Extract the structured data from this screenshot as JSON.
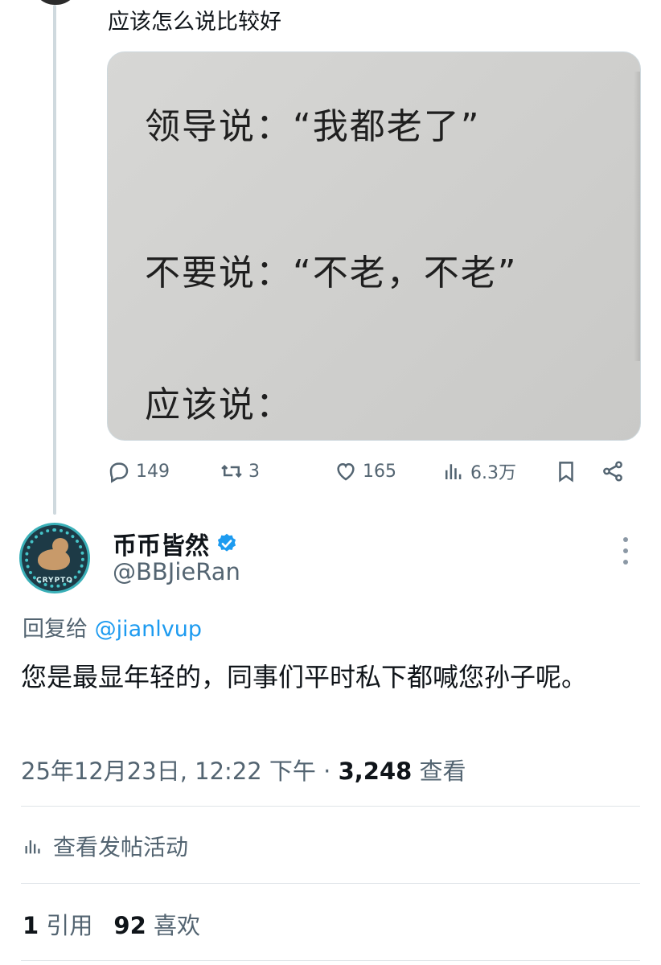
{
  "parent_tweet": {
    "text": "应该怎么说比较好",
    "media": {
      "line1": "领导说：“我都老了”",
      "line2": "不要说：“不老，不老”",
      "line3": "应该说："
    },
    "actions": {
      "replies": "149",
      "retweets": "3",
      "likes": "165",
      "views": "6.3万"
    },
    "icons": [
      "reply-icon",
      "retweet-icon",
      "like-icon",
      "views-icon",
      "bookmark-icon",
      "share-icon"
    ]
  },
  "reply_tweet": {
    "display_name": "币币皆然",
    "handle": "@BBJieRan",
    "reply_to_prefix": "回复给",
    "reply_to_mention": "@jianlvup",
    "text": "您是最显年轻的，同事们平时私下都喊您孙子呢。",
    "timestamp": "25年12月23日, 12:22 下午 · ",
    "view_count": "3,248",
    "view_label": " 查看",
    "avatar_text": "CRYPTO",
    "verified_color": "#1d9bf0"
  },
  "post_activity": {
    "label": "查看发帖活动"
  },
  "engagement": {
    "quotes_count": "1",
    "quotes_label": "引用",
    "likes_count": "92",
    "likes_label": "喜欢"
  },
  "colors": {
    "accent": "#1d9bf0",
    "secondary_text": "#536471",
    "primary_text": "#0f1419"
  }
}
